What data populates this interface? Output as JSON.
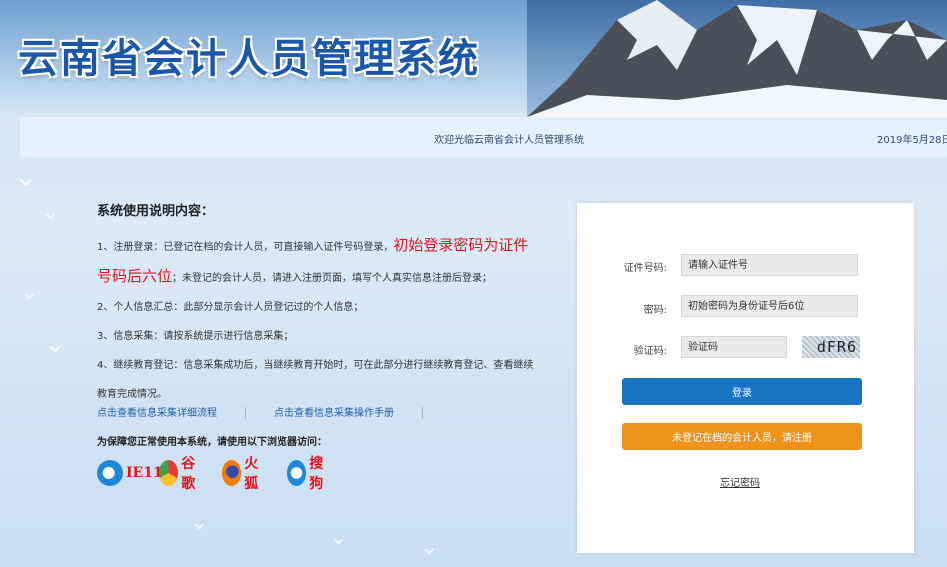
{
  "header": {
    "title": "云南省会计人员管理系统"
  },
  "bar": {
    "welcome": "欢迎光临云南省会计人员管理系统",
    "date": "2019年5月28日"
  },
  "instructions": {
    "heading": "系统使用说明内容：",
    "item1_pre": "1、注册登录：已登记在档的会计人员，可直接输入证件号码登录，",
    "item1_red": "初始登录密码为证件号码后六位",
    "item1_post": "；未登记的会计人员，请进入注册页面，填写个人真实信息注册后登录；",
    "item2": "2、个人信息汇总：此部分显示会计人员登记过的个人信息；",
    "item3": "3、信息采集：请按系统提示进行信息采集；",
    "item4": "4、继续教育登记：信息采集成功后，当继续教育开始时，可在此部分进行继续教育登记、查看继续教育完成情况。"
  },
  "links": {
    "flow": "点击查看信息采集详细流程",
    "manual": "点击查看信息采集操作手册"
  },
  "browser_tip": "为保障您正常使用本系统，请使用以下浏览器访问：",
  "browsers": [
    {
      "name": "IE11",
      "icon": "ie-icon",
      "color": "#1e88d8"
    },
    {
      "name": "谷歌",
      "icon": "chrome-icon",
      "color": "#e53935"
    },
    {
      "name": "火狐",
      "icon": "firefox-icon",
      "color": "#f57c00"
    },
    {
      "name": "搜狗",
      "icon": "sogou-icon",
      "color": "#1e88d8"
    }
  ],
  "login": {
    "id_label": "证件号码:",
    "id_placeholder": "请输入证件号",
    "pwd_label": "密码:",
    "pwd_placeholder": "初始密码为身份证号后6位",
    "captcha_label": "验证码:",
    "captcha_placeholder": "验证码",
    "captcha_text": "dFR6",
    "login_button": "登录",
    "register_button": "未登记在档的会计人员，请注册",
    "forgot": "忘记密码"
  },
  "colors": {
    "primary": "#1873c5",
    "warning": "#ee921c",
    "accent_red": "#e4141b",
    "title": "#1a57a8"
  }
}
